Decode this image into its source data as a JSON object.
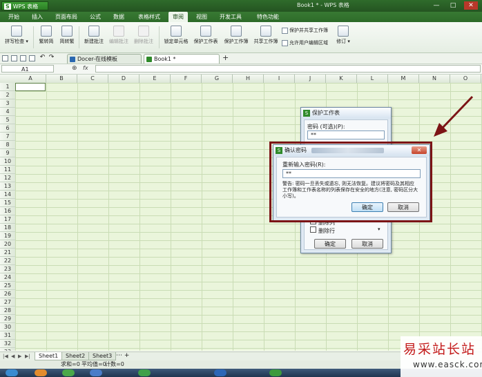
{
  "app": {
    "wps_button": "WPS 表格",
    "window_title": "Book1 * - WPS 表格",
    "window_controls": [
      "—",
      "□",
      "✕"
    ]
  },
  "menu_tabs": [
    "开始",
    "插入",
    "页面布局",
    "公式",
    "数据",
    "表格样式",
    "审阅",
    "视图",
    "开发工具",
    "特色功能"
  ],
  "active_menu_tab": "审阅",
  "ribbon": {
    "spellcheck": "拼写检查",
    "trad_to_simp": "繁转简",
    "simp_to_trad": "简转繁",
    "new_comment": "新建批注",
    "edit_comment": "编辑批注",
    "delete_comment": "删除批注",
    "lock_cell": "锁定单元格",
    "protect_sheet": "保护工作表",
    "protect_workbook": "保护工作簿",
    "share_workbook": "共享工作簿",
    "protect_and_share": "保护并共享工作簿",
    "allow_edit_ranges": "允许用户编辑区域",
    "track_changes": "修订"
  },
  "doc_tabs": [
    {
      "label": "Docer-在线模板"
    },
    {
      "label": "Book1 *"
    }
  ],
  "formula_bar": {
    "name_box": "A1",
    "fx": "fx",
    "value": ""
  },
  "columns": [
    "A",
    "B",
    "C",
    "D",
    "E",
    "F",
    "G",
    "H",
    "I",
    "J",
    "K",
    "L",
    "M",
    "N",
    "O"
  ],
  "rows": [
    "1",
    "2",
    "3",
    "4",
    "5",
    "6",
    "7",
    "8",
    "9",
    "10",
    "11",
    "12",
    "13",
    "14",
    "15",
    "16",
    "17",
    "18",
    "19",
    "20",
    "21",
    "22",
    "23",
    "24",
    "25",
    "26",
    "27",
    "28",
    "29",
    "30",
    "31",
    "32",
    "33"
  ],
  "sheets": [
    "Sheet1",
    "Sheet2",
    "Sheet3"
  ],
  "active_sheet": "Sheet1",
  "status": {
    "sum": "求和=0",
    "avg": "平均值=0",
    "count": "计数=0"
  },
  "protect_dialog": {
    "title": "保护工作表",
    "password_label": "密码 (可选)(P):",
    "password_value": "**",
    "options": [
      "删除列",
      "删除行"
    ],
    "ok": "确定",
    "cancel": "取消"
  },
  "confirm_dialog": {
    "title": "确认密码",
    "reenter_label": "重新输入密码(R):",
    "password_value": "**",
    "warning": "警告: 密码一旦丢失或遗忘, 则无法恢复。建议将密码及其相应工作簿和工作表名称的列表保存在安全的地方(注意, 密码区分大小写)。",
    "ok": "确定",
    "cancel": "取消",
    "close": "✕"
  },
  "watermark": {
    "title": "易采站长站",
    "url": "www.easck.com"
  },
  "colors": {
    "annotation": "#7c1416",
    "grid": "#eaf5db",
    "titlebar": "#2f6b2b"
  }
}
